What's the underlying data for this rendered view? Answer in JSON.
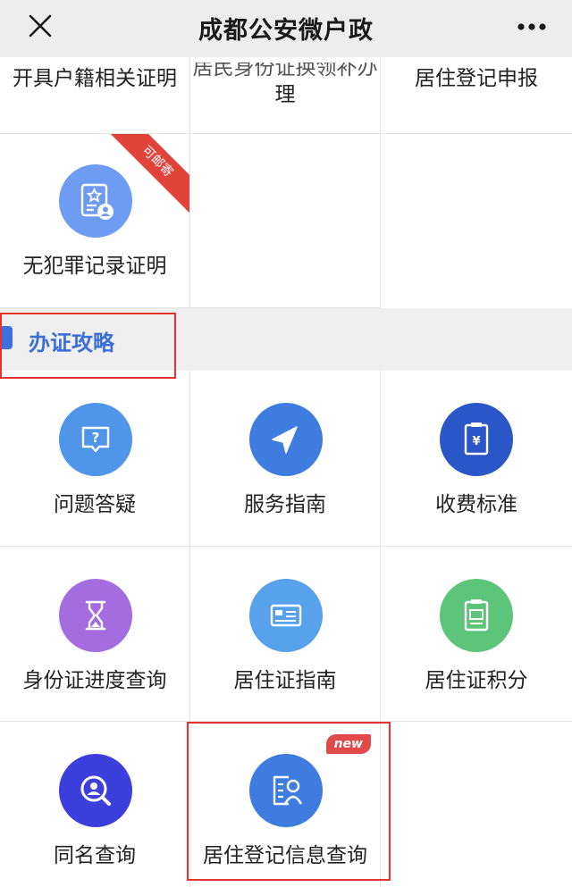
{
  "header": {
    "title": "成都公安微户政",
    "close_icon": "close-icon",
    "more_icon": "more-icon"
  },
  "services_top": [
    {
      "label": "开具户籍相关证明"
    },
    {
      "label": "理"
    },
    {
      "label": "居住登记申报"
    }
  ],
  "services_mid": [
    {
      "label": "无犯罪记录证明",
      "icon": "certificate-icon",
      "color": "#6f9cf3",
      "badge": "可邮寄"
    }
  ],
  "section": {
    "title": "办证攻略",
    "accent": "#3d6fe0"
  },
  "guides": [
    {
      "label": "问题答疑",
      "icon": "question-icon",
      "color": "#4f95e8"
    },
    {
      "label": "服务指南",
      "icon": "navigation-icon",
      "color": "#3e7ddf"
    },
    {
      "label": "收费标准",
      "icon": "fee-icon",
      "color": "#2b56c8"
    },
    {
      "label": "身份证进度查询",
      "icon": "hourglass-icon",
      "color": "#a56ce0"
    },
    {
      "label": "居住证指南",
      "icon": "id-card-icon",
      "color": "#57a2ea"
    },
    {
      "label": "居住证积分",
      "icon": "points-icon",
      "color": "#5cc57a"
    },
    {
      "label": "同名查询",
      "icon": "search-person-icon",
      "color": "#3d3fdc"
    },
    {
      "label": "居住登记信息查询",
      "icon": "residence-info-icon",
      "color": "#3e7ddf",
      "badge": "new"
    }
  ],
  "colors": {
    "highlight": "#e8322e",
    "badge_red": "#e0433a"
  }
}
